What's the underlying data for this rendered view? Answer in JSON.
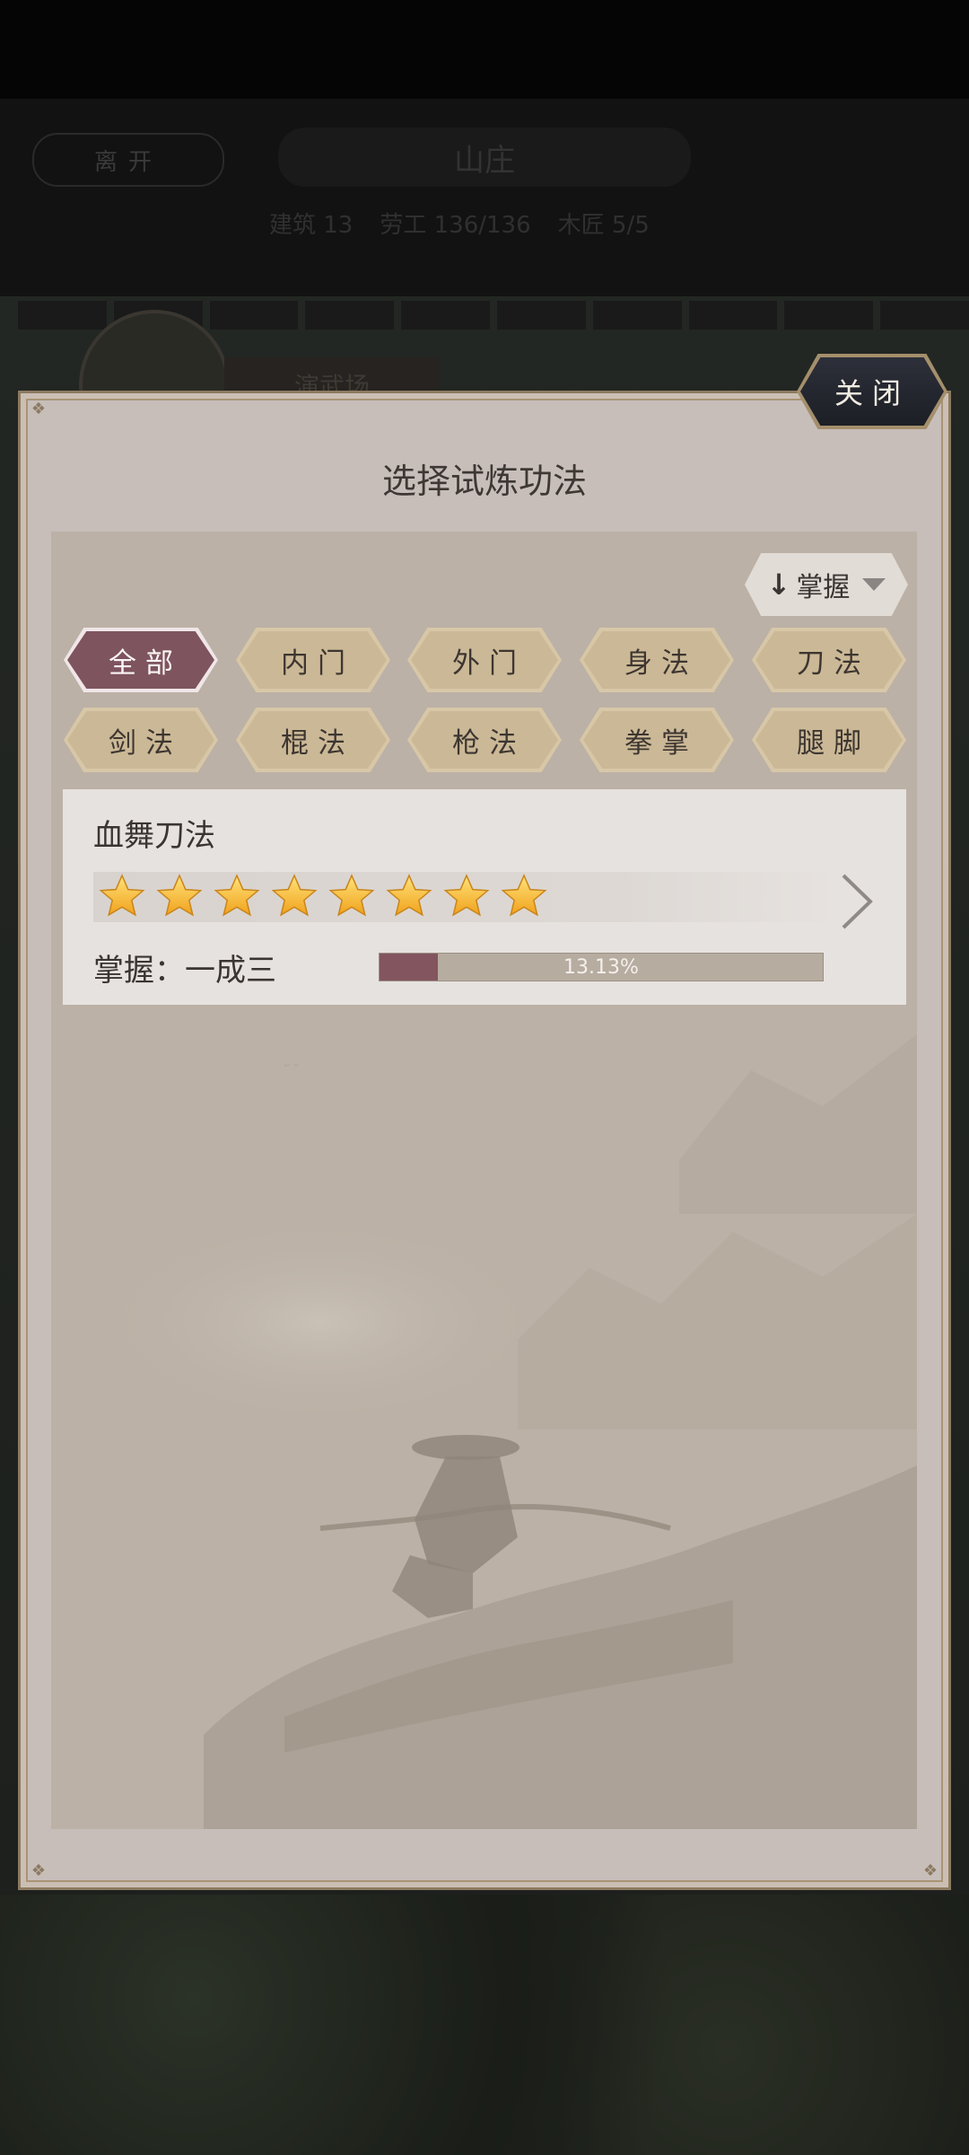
{
  "background": {
    "leave_label": "离开",
    "title": "山庄",
    "stats": [
      "建筑 13",
      "劳工 136/136",
      "木匠 5/5"
    ],
    "hall_label": "演武场"
  },
  "dialog": {
    "title": "选择试炼功法",
    "close_label": "关闭",
    "sort": {
      "label": "掌握",
      "direction": "descending"
    },
    "filters": [
      {
        "label": "全部",
        "active": true
      },
      {
        "label": "内门",
        "active": false
      },
      {
        "label": "外门",
        "active": false
      },
      {
        "label": "身法",
        "active": false
      },
      {
        "label": "刀法",
        "active": false
      },
      {
        "label": "剑法",
        "active": false
      },
      {
        "label": "棍法",
        "active": false
      },
      {
        "label": "枪法",
        "active": false
      },
      {
        "label": "拳掌",
        "active": false
      },
      {
        "label": "腿脚",
        "active": false
      }
    ],
    "skills": [
      {
        "name": "血舞刀法",
        "stars": 8,
        "mastery_label": "掌握：一成三",
        "progress": 0.1313,
        "progress_text": "13.13%"
      }
    ]
  },
  "colors": {
    "active_filter": "#7e545e",
    "filter": "#cbb896",
    "progress_fill": "#82555f",
    "dialog_bg": "#c7beba"
  }
}
